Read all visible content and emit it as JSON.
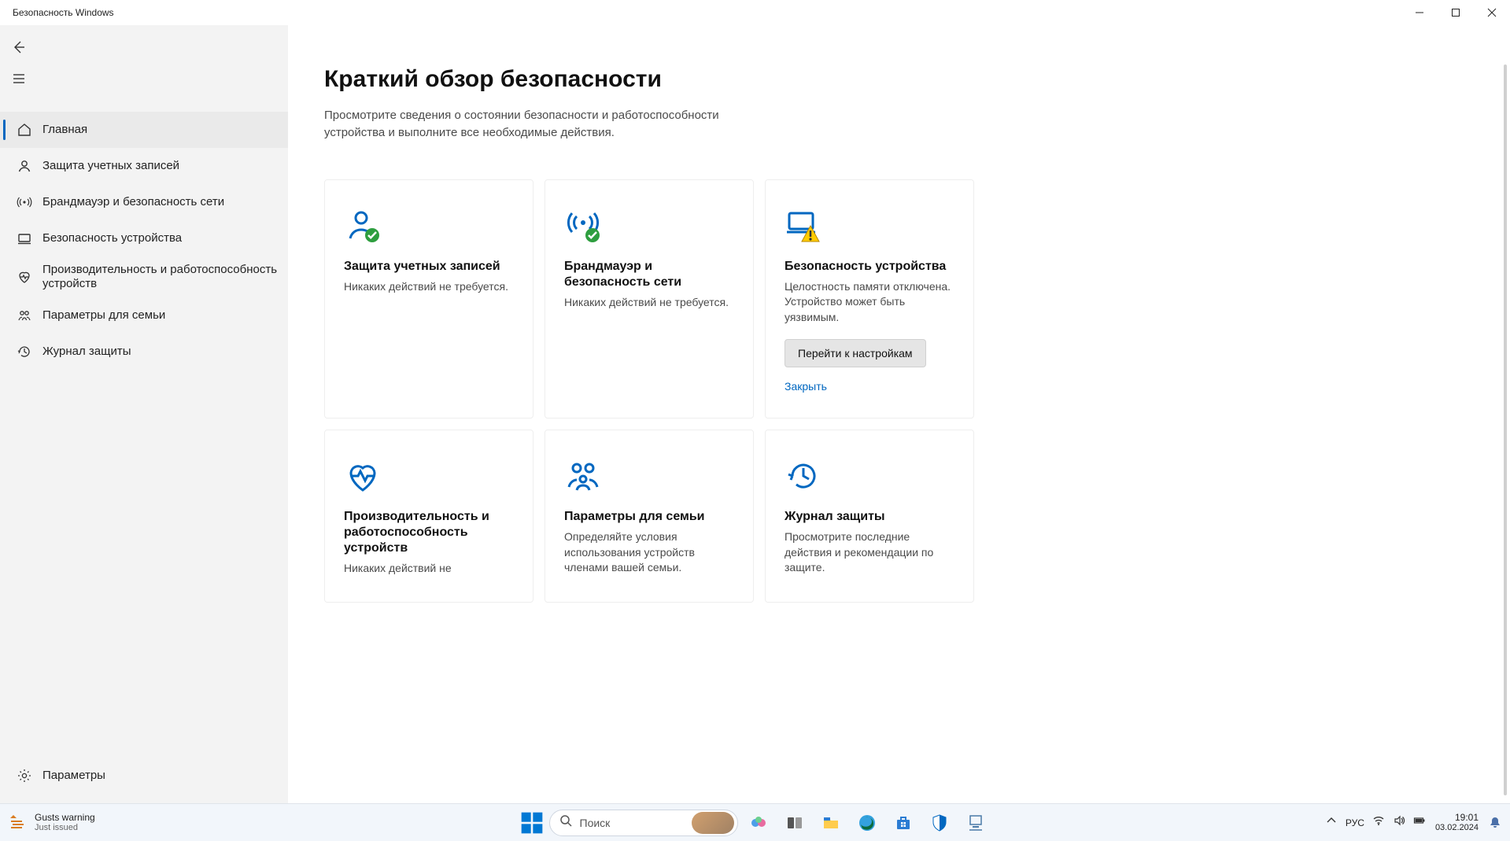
{
  "window": {
    "title": "Безопасность Windows"
  },
  "sidebar": {
    "items": [
      {
        "label": "Главная",
        "icon": "home"
      },
      {
        "label": "Защита учетных записей",
        "icon": "account"
      },
      {
        "label": "Брандмауэр и безопасность сети",
        "icon": "network"
      },
      {
        "label": "Безопасность устройства",
        "icon": "device"
      },
      {
        "label": "Производительность и работоспособность устройств",
        "icon": "health"
      },
      {
        "label": "Параметры для семьи",
        "icon": "family"
      },
      {
        "label": "Журнал защиты",
        "icon": "history"
      }
    ],
    "bottom": {
      "label": "Параметры",
      "icon": "settings"
    }
  },
  "main": {
    "title": "Краткий обзор безопасности",
    "subtitle": "Просмотрите сведения о состоянии безопасности и работоспособности устройства и выполните все необходимые действия.",
    "cards": [
      {
        "title": "Защита учетных записей",
        "desc": "Никаких действий не требуется.",
        "icon": "account",
        "status": "ok"
      },
      {
        "title": "Брандмауэр и безопасность сети",
        "desc": "Никаких действий не требуется.",
        "icon": "network",
        "status": "ok"
      },
      {
        "title": "Безопасность устройства",
        "desc": "Целостность памяти отключена. Устройство может быть уязвимым.",
        "icon": "device",
        "status": "warn",
        "button": "Перейти к настройкам",
        "link": "Закрыть"
      },
      {
        "title": "Производительность и работоспособность устройств",
        "desc": "Никаких действий не",
        "icon": "health",
        "status": "none"
      },
      {
        "title": "Параметры для семьи",
        "desc": "Определяйте условия использования устройств членами вашей семьи.",
        "icon": "family",
        "status": "none"
      },
      {
        "title": "Журнал защиты",
        "desc": "Просмотрите последние действия и рекомендации по защите.",
        "icon": "history",
        "status": "none"
      }
    ]
  },
  "taskbar": {
    "weather": {
      "line1": "Gusts warning",
      "line2": "Just issued"
    },
    "search_placeholder": "Поиск",
    "lang": "РУС",
    "time": "19:01",
    "date": "03.02.2024"
  }
}
